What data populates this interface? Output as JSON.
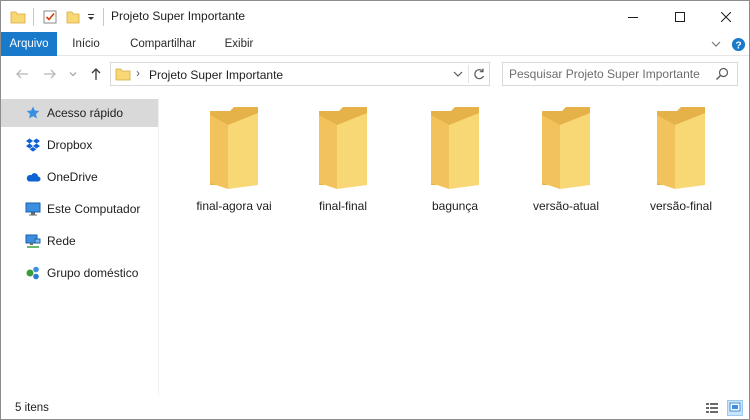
{
  "window": {
    "title": "Projeto Super Importante"
  },
  "ribbon": {
    "tabs": [
      {
        "label": "Arquivo"
      },
      {
        "label": "Início"
      },
      {
        "label": "Compartilhar"
      },
      {
        "label": "Exibir"
      }
    ]
  },
  "address": {
    "path": "Projeto Super Importante"
  },
  "search": {
    "placeholder": "Pesquisar Projeto Super Importante"
  },
  "sidebar": {
    "items": [
      {
        "label": "Acesso rápido",
        "icon": "star-icon",
        "selected": true
      },
      {
        "label": "Dropbox",
        "icon": "dropbox-icon"
      },
      {
        "label": "OneDrive",
        "icon": "cloud-icon"
      },
      {
        "label": "Este Computador",
        "icon": "computer-icon"
      },
      {
        "label": "Rede",
        "icon": "network-icon"
      },
      {
        "label": "Grupo doméstico",
        "icon": "homegroup-icon"
      }
    ]
  },
  "folders": [
    {
      "name": "final-agora vai"
    },
    {
      "name": "final-final"
    },
    {
      "name": "bagunça"
    },
    {
      "name": "versão-atual"
    },
    {
      "name": "versão-final"
    }
  ],
  "status": {
    "count": "5 itens"
  },
  "colors": {
    "accent": "#1979ca",
    "folder": "#f8d775",
    "folder_dark": "#e8b84a",
    "selected": "#d9d9d9"
  }
}
